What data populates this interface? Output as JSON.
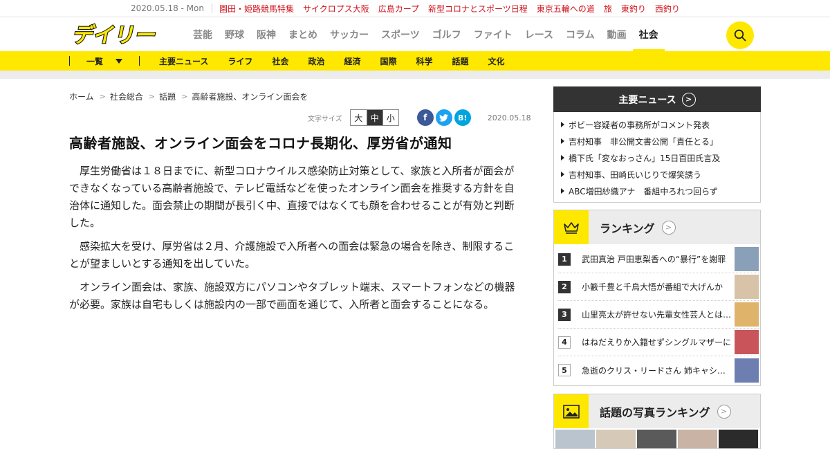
{
  "topbar": {
    "date": "2020.05.18 - Mon",
    "links": [
      "園田・姫路競馬特集",
      "サイクロプス大阪",
      "広島カープ",
      "新型コロナとスポーツ日程",
      "東京五輪への道",
      "旅",
      "東釣り",
      "西釣り"
    ]
  },
  "header": {
    "logo_text": "デイリー",
    "nav": [
      "芸能",
      "野球",
      "阪神",
      "まとめ",
      "サッカー",
      "スポーツ",
      "ゴルフ",
      "ファイト",
      "レース",
      "コラム",
      "動画",
      "社会"
    ],
    "active_nav": "社会"
  },
  "subnav": {
    "list_label": "一覧",
    "items": [
      "主要ニュース",
      "ライフ",
      "社会",
      "政治",
      "経済",
      "国際",
      "科学",
      "話題",
      "文化"
    ]
  },
  "breadcrumb": [
    "ホーム",
    "社会総合",
    "話題",
    "高齢者施設、オンライン面会を"
  ],
  "tools": {
    "font_size_label": "文字サイズ",
    "sizes": [
      "大",
      "中",
      "小"
    ],
    "selected_size": "中",
    "social": [
      {
        "name": "facebook",
        "glyph": "f",
        "color": "#3b5998"
      },
      {
        "name": "twitter",
        "glyph": "t",
        "color": "#1da1f2"
      },
      {
        "name": "hatena",
        "glyph": "B!",
        "color": "#00a4de"
      }
    ],
    "pub_date": "2020.05.18"
  },
  "article": {
    "headline": "高齢者施設、オンライン面会をコロナ長期化、厚労省が通知",
    "paragraphs": [
      "厚生労働省は１８日までに、新型コロナウイルス感染防止対策として、家族と入所者が面会ができなくなっている高齢者施設で、テレビ電話などを使ったオンライン面会を推奨する方針を自治体に通知した。面会禁止の期間が長引く中、直接ではなくても顔を合わせることが有効と判断した。",
      "感染拡大を受け、厚労省は２月、介護施設で入所者への面会は緊急の場合を除き、制限することが望ましいとする通知を出していた。",
      "オンライン面会は、家族、施設双方にパソコンやタブレット端末、スマートフォンなどの機器が必要。家族は自宅もしくは施設内の一部で画面を通じて、入所者と面会することになる。"
    ]
  },
  "sidebar": {
    "major_news": {
      "title": "主要ニュース",
      "items": [
        "ボビー容疑者の事務所がコメント発表",
        "吉村知事　非公開文書公開「責任とる」",
        "橋下氏「変なおっさん」15日百田氏言及",
        "吉村知事、田崎氏いじりで爆笑誘う",
        "ABC増田紗織アナ　番組中ろれつ回らず"
      ]
    },
    "ranking": {
      "title": "ランキング",
      "items": [
        {
          "rank": "1",
          "text": "武田真治 戸田恵梨香への“暴行”を謝罪",
          "thumb_color": "#8aa0b8"
        },
        {
          "rank": "2",
          "text": "小籔千豊と千鳥大悟が番組で大げんか",
          "thumb_color": "#d9c3a8"
        },
        {
          "rank": "3",
          "text": "山里亮太が許せない先輩女性芸人とは…",
          "thumb_color": "#e0b36a"
        },
        {
          "rank": "4",
          "text": "はねだえりか入籍せずシングルマザーに",
          "thumb_color": "#c9555a"
        },
        {
          "rank": "5",
          "text": "急逝のクリス・リードさん 姉キャシー・リードさん",
          "thumb_color": "#6d7fb0"
        }
      ]
    },
    "photo_ranking": {
      "title": "話題の写真ランキング",
      "thumb_colors": [
        "#b9c4cf",
        "#d7c9b8",
        "#5a5a5a",
        "#c8b3a4",
        "#2b2b2b"
      ]
    }
  },
  "colors": {
    "brand_yellow": "#ffe800",
    "accent_red": "#d0121b",
    "dark": "#333333"
  }
}
